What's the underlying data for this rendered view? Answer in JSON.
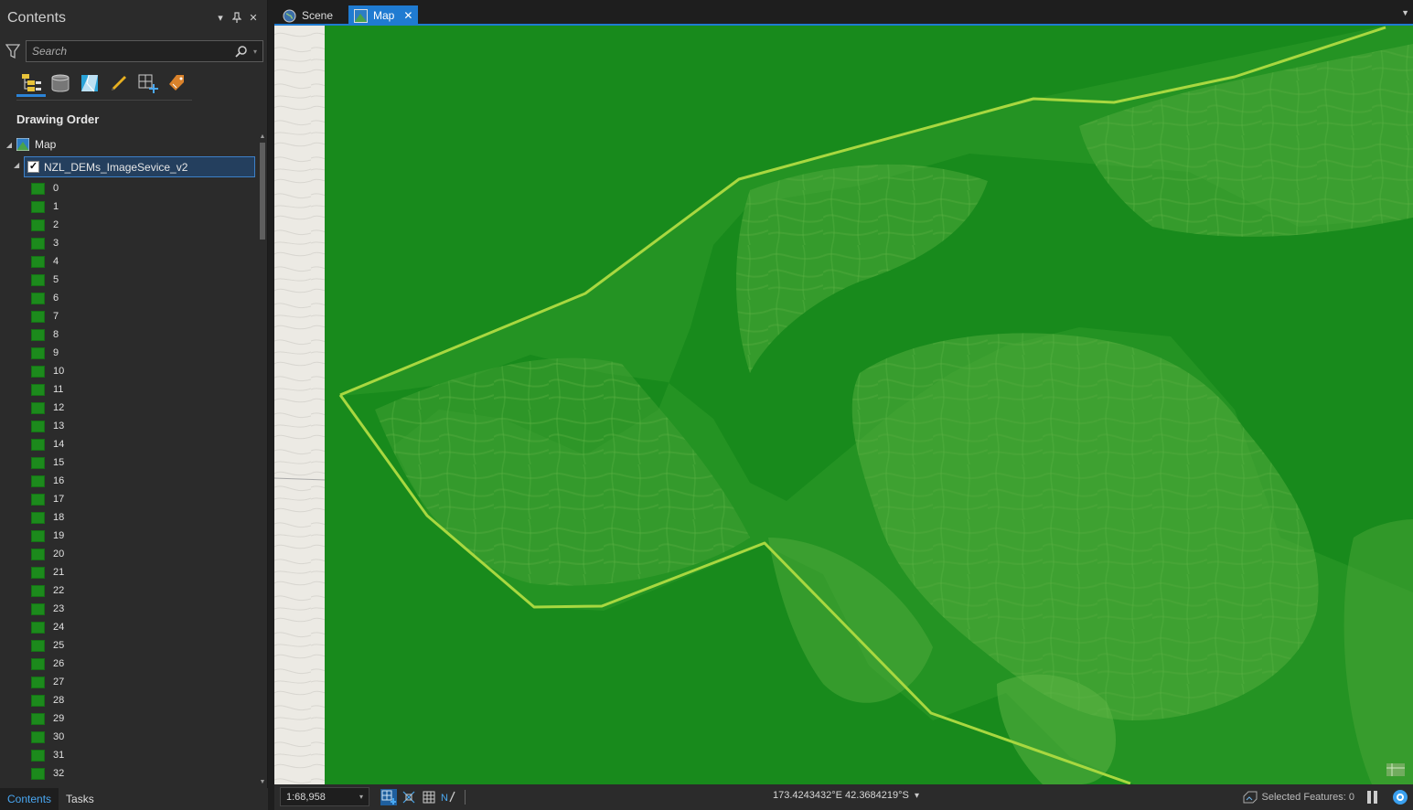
{
  "contents_pane": {
    "title": "Contents",
    "search_placeholder": "Search",
    "section_title": "Drawing Order",
    "map_node_label": "Map",
    "layer_label": "NZL_DEMs_ImageSevice_v2",
    "class_labels": [
      "0",
      "1",
      "2",
      "3",
      "4",
      "5",
      "6",
      "7",
      "8",
      "9",
      "10",
      "11",
      "12",
      "13",
      "14",
      "15",
      "16",
      "17",
      "18",
      "19",
      "20",
      "21",
      "22",
      "23",
      "24",
      "25",
      "26",
      "27",
      "28",
      "29",
      "30",
      "31",
      "32"
    ],
    "class_color": "#1c8a1c",
    "bottom_tabs": [
      "Contents",
      "Tasks"
    ]
  },
  "doc_tabs": {
    "scene_label": "Scene",
    "map_label": "Map"
  },
  "status_bar": {
    "scale": "1:68,958",
    "coordinates": "173.4243432°E 42.3684219°S",
    "selected_features": "Selected Features: 0"
  },
  "colors": {
    "accent": "#1f7bd1",
    "raster_base": "#1a8a1a",
    "raster_highlight": "#8ccc3a",
    "boundary": "#a8d840"
  }
}
